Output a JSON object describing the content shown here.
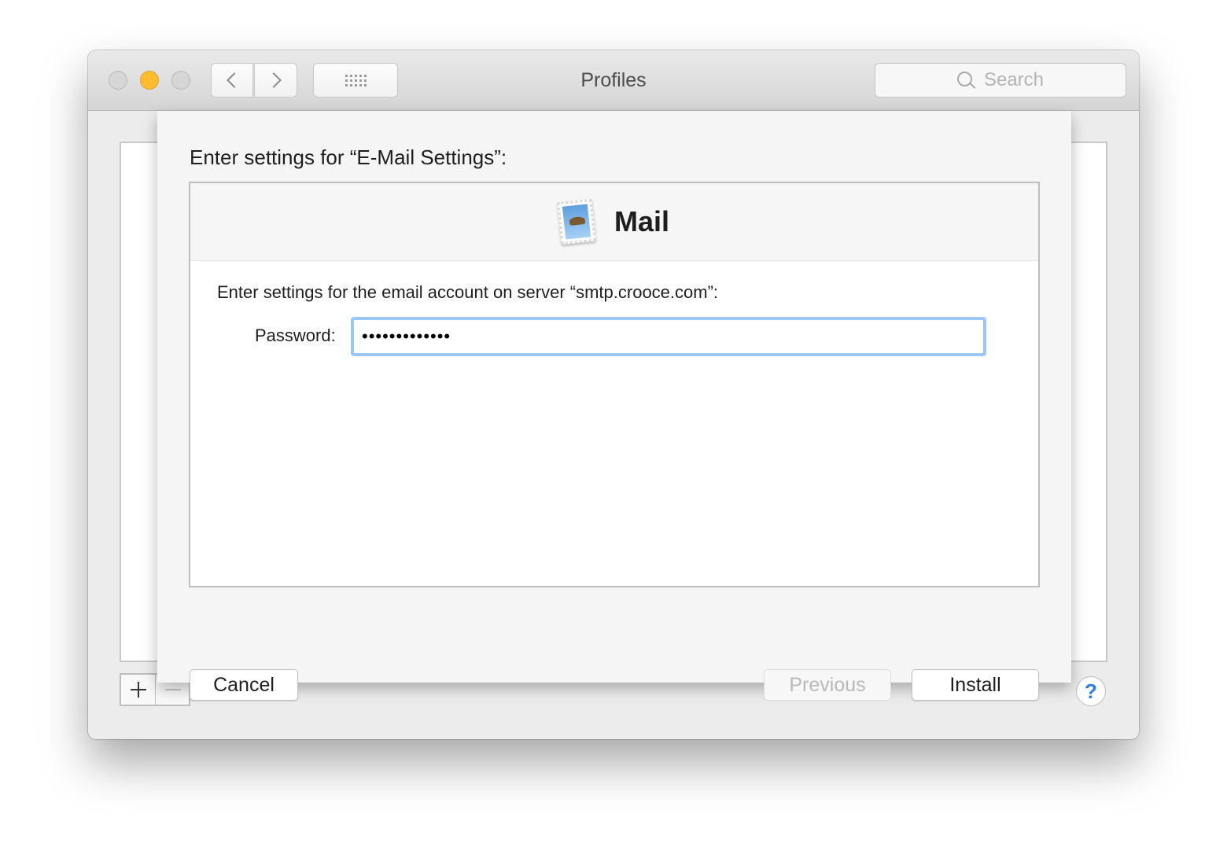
{
  "window": {
    "title": "Profiles"
  },
  "toolbar": {
    "back_icon": "chevron-left-icon",
    "forward_icon": "chevron-right-icon",
    "grid_icon": "grid-icon",
    "search_placeholder": "Search"
  },
  "sheet": {
    "title": "Enter settings for “E-Mail Settings”:",
    "app_name": "Mail",
    "app_icon": "mail-stamp-icon",
    "instruction": "Enter settings for the email account on server “smtp.crooce.com”:",
    "password_label": "Password:",
    "password_value": "•••••••••••••",
    "buttons": {
      "cancel": "Cancel",
      "previous": "Previous",
      "install": "Install"
    }
  },
  "footer": {
    "help_label": "?"
  },
  "colors": {
    "minimize_light": "#fdbc2f",
    "focus_ring": "#9cc7f4",
    "help_accent": "#2a7de2"
  }
}
